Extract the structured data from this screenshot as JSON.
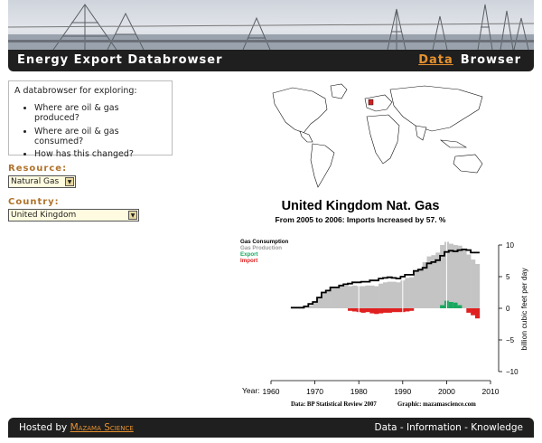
{
  "header": {
    "title": "Energy Export Databrowser",
    "nav_data": "Data",
    "nav_browser": "Browser"
  },
  "intro": {
    "heading": "A databrowser for exploring:",
    "items": [
      "Where are oil & gas produced?",
      "Where are oil & gas consumed?",
      "How has this changed?"
    ]
  },
  "controls": {
    "resource_label": "Resource:",
    "resource_value": "Natural Gas",
    "country_label": "Country:",
    "country_value": "United Kingdom"
  },
  "chart_data": {
    "type": "area",
    "title": "United Kingdom Nat. Gas",
    "subtitle": "From 2005 to 2006:  Imports Increased by 57. %",
    "legend": [
      "Gas Consumption",
      "Gas Production",
      "Export",
      "Import"
    ],
    "xlabel": "Year:",
    "ylabel": "billion cubic feet per day",
    "xlim": [
      1960,
      2010
    ],
    "ylim": [
      -10,
      10
    ],
    "x_ticks": [
      "1960",
      "1970",
      "1980",
      "1990",
      "2000",
      "2010"
    ],
    "y_ticks": [
      "10",
      "5",
      "0",
      "−5",
      "−10"
    ],
    "years": [
      1965,
      1966,
      1967,
      1968,
      1969,
      1970,
      1971,
      1972,
      1973,
      1974,
      1975,
      1976,
      1977,
      1978,
      1979,
      1980,
      1981,
      1982,
      1983,
      1984,
      1985,
      1986,
      1987,
      1988,
      1989,
      1990,
      1991,
      1992,
      1993,
      1994,
      1995,
      1996,
      1997,
      1998,
      1999,
      2000,
      2001,
      2002,
      2003,
      2004,
      2005,
      2006,
      2007
    ],
    "consumption": [
      0.1,
      0.1,
      0.1,
      0.3,
      0.7,
      1.0,
      1.7,
      2.5,
      2.8,
      3.3,
      3.3,
      3.6,
      3.8,
      3.9,
      4.1,
      4.1,
      4.2,
      4.2,
      4.4,
      4.4,
      4.7,
      4.8,
      4.9,
      4.8,
      4.7,
      5.0,
      5.3,
      5.3,
      5.9,
      6.1,
      6.4,
      7.1,
      7.3,
      7.6,
      8.3,
      8.9,
      9.1,
      9.0,
      9.2,
      9.3,
      9.2,
      8.8,
      8.8
    ],
    "production": [
      0,
      0,
      0,
      0.1,
      0.5,
      1.0,
      1.8,
      2.6,
      2.9,
      3.3,
      3.4,
      3.6,
      3.6,
      3.5,
      3.6,
      3.5,
      3.5,
      3.6,
      3.6,
      3.5,
      3.9,
      4.1,
      4.2,
      4.2,
      4.1,
      4.4,
      4.8,
      4.9,
      6.0,
      6.3,
      7.3,
      8.2,
      8.4,
      8.8,
      10.0,
      10.5,
      10.2,
      10.0,
      9.9,
      9.3,
      8.5,
      7.7,
      7.0
    ],
    "export": [
      0,
      0,
      0,
      0,
      0,
      0,
      0,
      0,
      0,
      0,
      0,
      0,
      0,
      0,
      0,
      0,
      0,
      0,
      0,
      0,
      0,
      0,
      0,
      0,
      0,
      0,
      0,
      0,
      0,
      0,
      0,
      0,
      0,
      0,
      0.5,
      1.2,
      1.0,
      0.9,
      0.5,
      0,
      0,
      0,
      0
    ],
    "import": [
      0,
      0,
      0,
      0,
      0,
      0,
      0,
      0,
      0,
      0,
      0,
      0,
      0,
      -0.4,
      -0.5,
      -0.6,
      -0.7,
      -0.6,
      -0.8,
      -0.9,
      -0.8,
      -0.7,
      -0.7,
      -0.6,
      -0.6,
      -0.6,
      -0.5,
      -0.4,
      0,
      0,
      0,
      0,
      0,
      0,
      0,
      0,
      0,
      0,
      0,
      0,
      -0.7,
      -1.1,
      -1.6
    ],
    "caption_left": "Data: BP Statistical Review 2007",
    "caption_right": "Graphic: mazamascience.com",
    "colors": {
      "consumption": "#000000",
      "production": "#c4c4c4",
      "export": "#1aa860",
      "import": "#e02020"
    }
  },
  "footer": {
    "hosted_prefix": "Hosted by",
    "hosted_link": "Mazama Science",
    "right_links": "Data - Information - Knowledge"
  }
}
